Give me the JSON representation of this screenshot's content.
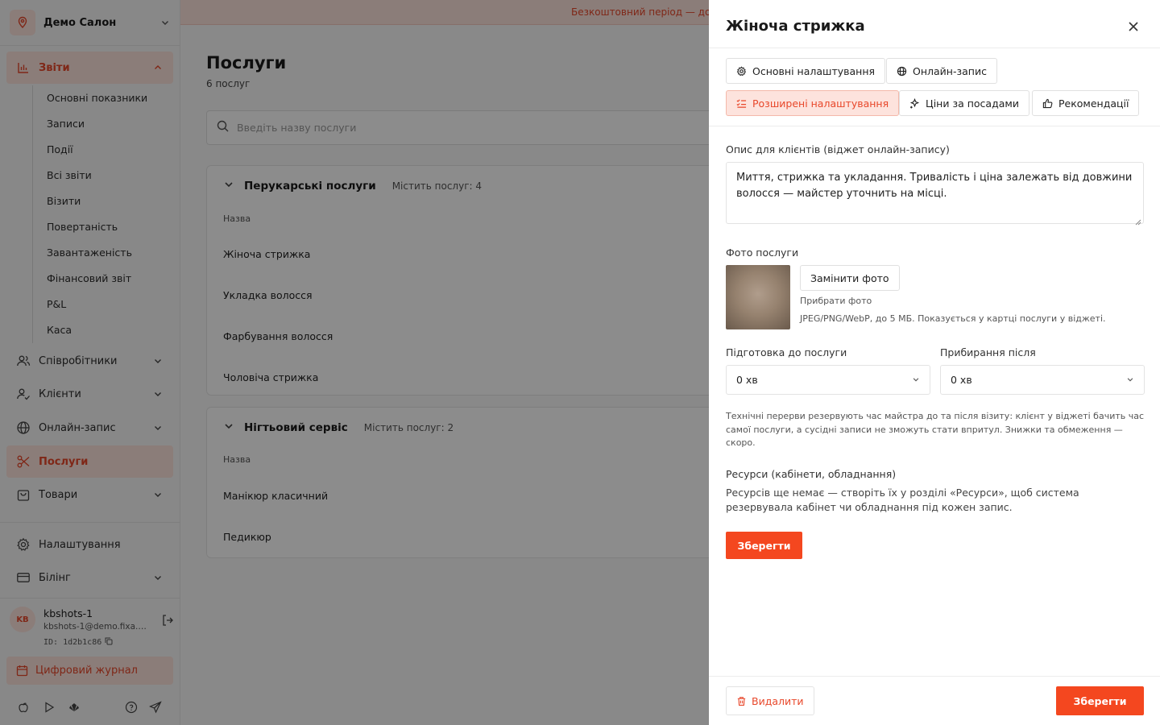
{
  "colors": {
    "accent": "#f4471f",
    "accent_soft": "#fde3dd",
    "text": "#1f1f1f",
    "muted": "#555555"
  },
  "sidebar": {
    "salon_name": "Демо Салон",
    "reports": {
      "label": "Звіти",
      "items": [
        "Основні показники",
        "Записи",
        "Події",
        "Всі звіти",
        "Візити",
        "Повертаність",
        "Завантаженість",
        "Фінансовий звіт",
        "P&L",
        "Каса"
      ]
    },
    "nav": {
      "staff": "Співробітники",
      "clients": "Клієнти",
      "online": "Онлайн-запис",
      "services": "Послуги",
      "goods": "Товари",
      "settings": "Налаштування",
      "billing": "Білінг"
    },
    "user": {
      "initials": "KB",
      "name": "kbshots-1",
      "email": "kbshots-1@demo.fixa.b...",
      "id": "ID: 1d2b1c86"
    },
    "journal": "Цифровий журнал",
    "bottom_icons": [
      "apple-icon",
      "play-icon",
      "huawei-icon",
      "help-icon",
      "send-icon"
    ]
  },
  "main": {
    "banner": "Безкоштовний період — до",
    "title": "Послуги",
    "subtitle": "6 послуг",
    "search_placeholder": "Введіть назву послуги",
    "groups": [
      {
        "title": "Перукарські послуги",
        "count": "Містить послуг: 4",
        "column": "Назва",
        "rows": [
          "Жіноча стрижка",
          "Укладка волосся",
          "Фарбування волосся",
          "Чоловіча стрижка"
        ]
      },
      {
        "title": "Нігтьовий сервіс",
        "count": "Містить послуг: 2",
        "column": "Назва",
        "rows": [
          "Манікюр класичний",
          "Педикюр"
        ]
      }
    ]
  },
  "panel": {
    "title": "Жіноча стрижка",
    "tabs": [
      "Основні налаштування",
      "Онлайн-запис",
      "Розширені налаштування",
      "Ціни за посадами",
      "Рекомендації"
    ],
    "active_tab": "Розширені налаштування",
    "description_label": "Опис для клієнтів (віджет онлайн-запису)",
    "description_value": "Миття, стрижка та укладання. Тривалість і ціна залежать від довжини волосся — майстер уточнить на місці.",
    "photo_label": "Фото послуги",
    "replace_photo": "Замінити фото",
    "remove_photo": "Прибрати фото",
    "photo_hint": "JPEG/PNG/WebP, до 5 МБ. Показується у картці послуги у віджеті.",
    "prep_label": "Підготовка до послуги",
    "prep_value": "0 хв",
    "cleanup_label": "Прибирання після",
    "cleanup_value": "0 хв",
    "breaks_hint": "Технічні перерви резервують час майстра до та після візиту: клієнт у віджеті бачить час самої послуги, а сусідні записи не зможуть стати впритул. Знижки та обмеження — скоро.",
    "resources_label": "Ресурси (кабінети, обладнання)",
    "resources_text": "Ресурсів ще немає — створіть їх у розділі «Ресурси», щоб система резервувала кабінет чи обладнання під кожен запис.",
    "save_inline": "Зберегти",
    "delete": "Видалити",
    "save_footer": "Зберегти"
  }
}
